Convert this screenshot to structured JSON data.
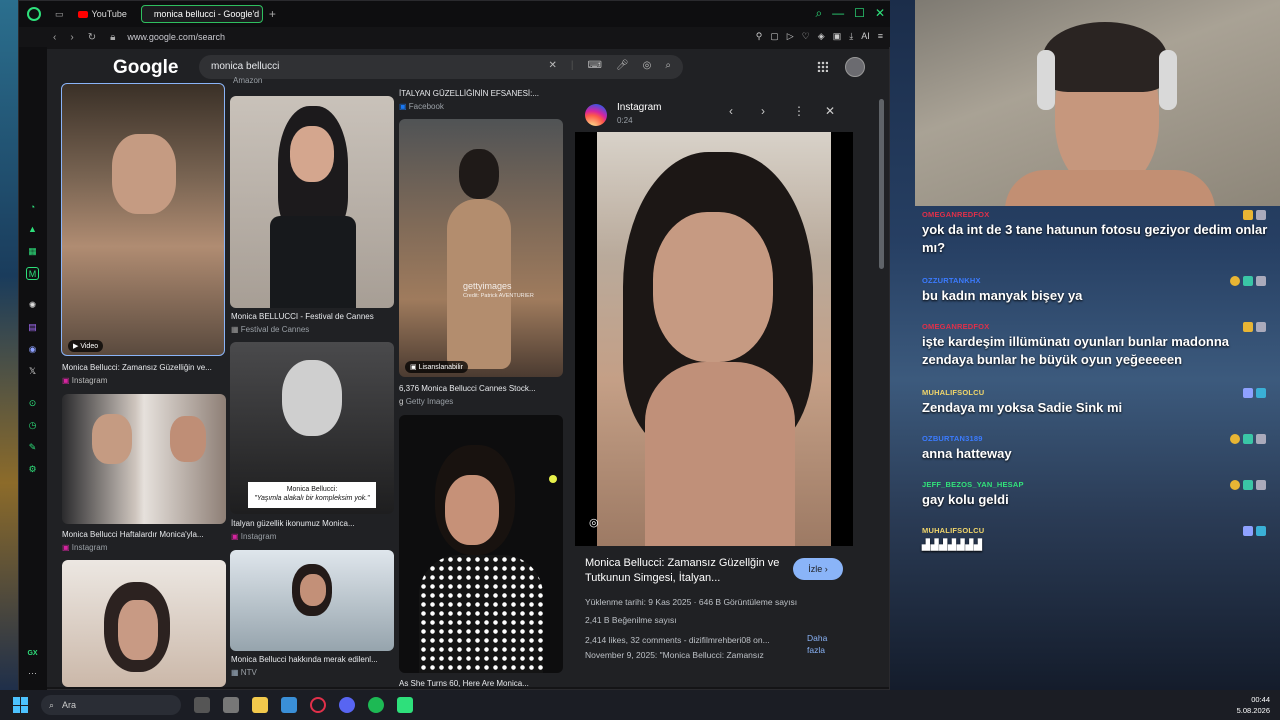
{
  "browser": {
    "tabs": [
      {
        "label": "YouTube",
        "active": false
      },
      {
        "label": "monica bellucci - Google'd",
        "active": true
      }
    ],
    "url": "www.google.com/search",
    "ai_label": "AI"
  },
  "google": {
    "logo": "Google",
    "query": "monica bellucci",
    "results": [
      {
        "caption": "Monica Bellucci: Zamansız Güzelliğin ve...",
        "source": "Instagram",
        "badge": "Video"
      },
      {
        "caption": "Monica BELLUCCI - Festival de Cannes",
        "source": "Festival de Cannes"
      },
      {
        "caption": "İTALYAN GÜZELLİĞİNİN EFSANESİ:...",
        "source": "Facebook"
      },
      {
        "caption": "6,376 Monica Bellucci Cannes Stock...",
        "source": "Getty Images",
        "badge": "Lisanslanabilir"
      },
      {
        "caption": "Monica Bellucci Haftalardır Monica'yla...",
        "source": "Instagram"
      },
      {
        "caption": "İtalyan güzellik ikonumuz Monica...",
        "source": "Instagram"
      },
      {
        "caption": "Monica Bellucci hakkında merak edilenl...",
        "source": "NTV"
      },
      {
        "caption": "As She Turns 60, Here Are Monica...",
        "source": ""
      }
    ],
    "overlay_text": {
      "line1": "Monica Bellucci:",
      "line2": "\"Yaşımla alakalı bir kompleksim yok.\""
    },
    "watermark": "gettyimages",
    "watermark_credit": "Credit: Patrick AVENTURIER",
    "top_caption_partial": "Amazon"
  },
  "preview": {
    "source": "Instagram",
    "duration": "0:24",
    "title": "Monica Bellucci: Zamansız Güzellğin ve Tutkunun Simgesi, İtalyan...",
    "watch_label": "İzle",
    "uploaded": "Yüklenme tarihi: 9 Kas 2025",
    "views": "646 B Görüntüleme sayısı",
    "likes": "2,41 B Beğenilme sayısı",
    "desc1": "2,414 likes, 32 comments - dizifilmrehberi08 on...",
    "desc2": "November 9, 2025: \"Monica Bellucci: Zamansız",
    "more": "Daha fazla"
  },
  "taskbar": {
    "search_placeholder": "Ara",
    "time": "00:44",
    "date": "5.08.2026"
  },
  "chat": {
    "messages": [
      {
        "user": "OMEGANREDFOX",
        "color": "#e0304a",
        "text": "yok da int de 3 tane hatunun fotosu geziyor dedim onlar mı?"
      },
      {
        "user": "OZZURTANKHX",
        "color": "#3b7bff",
        "text": "bu kadın manyak bişey ya"
      },
      {
        "user": "OMEGANREDFOX",
        "color": "#e0304a",
        "text": "işte kardeşim illümünatı oyunları bunlar madonna zendaya bunlar he büyük oyun yeğeeeeen"
      },
      {
        "user": "MUHALIFSOLCU",
        "color": "#f0d56a",
        "text": "Zendaya mı yoksa Sadie Sink mi"
      },
      {
        "user": "OZBURTAN3189",
        "color": "#3b7bff",
        "text": "anna hatteway"
      },
      {
        "user": "JEFF_BEZOS_YAN_HESAP",
        "color": "#32e27a",
        "text": "gay kolu geldi"
      },
      {
        "user": "MUHALIFSOLCU",
        "color": "#f0d56a",
        "text": ""
      }
    ]
  },
  "colors": {
    "accent": "#2ee07b",
    "link": "#8ab4f8",
    "page_bg": "#202124"
  }
}
